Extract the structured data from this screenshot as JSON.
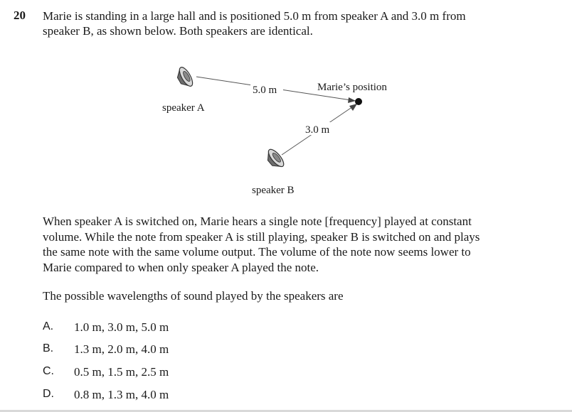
{
  "question": {
    "number": "20",
    "stem_line1": "Marie is standing in a large hall and is positioned 5.0 m from speaker A and 3.0 m from",
    "stem_line2": "speaker B, as shown below. Both speakers are identical."
  },
  "diagram": {
    "speaker_a_label": "speaker A",
    "speaker_b_label": "speaker B",
    "distance_a": "5.0 m",
    "distance_b": "3.0 m",
    "marie_label": "Marie’s position"
  },
  "paragraph1": {
    "line1": "When speaker A is switched on, Marie hears a single note [frequency] played at constant",
    "line2": "volume. While the note from speaker A is still playing, speaker B is switched on and plays",
    "line3": "the same note with the same volume output. The volume of the note now seems lower to",
    "line4": "Marie compared to when only speaker A played the note."
  },
  "paragraph2": "The possible wavelengths of sound played by the speakers are",
  "options": [
    {
      "letter": "A.",
      "text": "1.0 m, 3.0 m, 5.0 m"
    },
    {
      "letter": "B.",
      "text": "1.3 m, 2.0 m, 4.0 m"
    },
    {
      "letter": "C.",
      "text": "0.5 m, 1.5 m, 2.5 m"
    },
    {
      "letter": "D.",
      "text": "0.8 m, 1.3 m, 4.0 m"
    }
  ]
}
